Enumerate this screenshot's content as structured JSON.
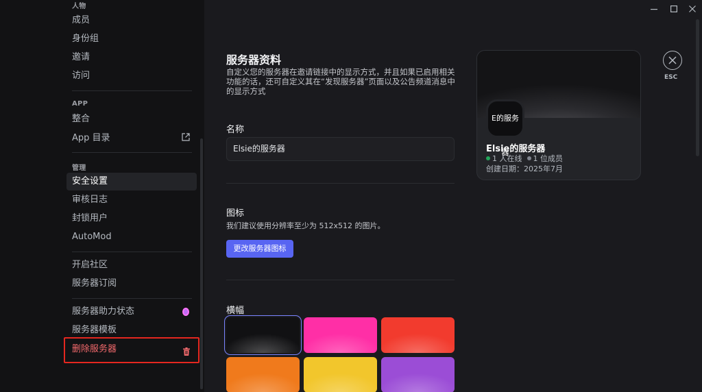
{
  "sidebar": {
    "sections": {
      "people": "人物",
      "app": "APP",
      "manage": "管理"
    },
    "items": {
      "members": "成员",
      "roles": "身份组",
      "invites": "邀请",
      "access": "访问",
      "integrations": "整合",
      "app_directory": "App 目录",
      "safety": "安全设置",
      "audit_log": "审核日志",
      "bans": "封锁用户",
      "automod": "AutoMod",
      "community": "开启社区",
      "subscriptions": "服务器订阅",
      "boost_status": "服务器助力状态",
      "template": "服务器模板",
      "delete_server": "删除服务器"
    }
  },
  "main": {
    "title": "服务器资料",
    "description": "自定义您的服务器在邀请链接中的显示方式，并且如果已启用相关功能的话，还可自定义其在“发现服务器”页面以及公告频道消息中的显示方式",
    "name_label": "名称",
    "name_value": "Elsie的服务器",
    "icon_label": "图标",
    "icon_hint": "我们建议使用分辨率至少为 512x512 的图片。",
    "change_icon_button": "更改服务器图标",
    "banner_label": "横幅"
  },
  "banners": [
    {
      "name": "black",
      "color": "#111113",
      "selected": true
    },
    {
      "name": "pink",
      "color": "#ff2fa6"
    },
    {
      "name": "red",
      "color": "#f23b2e"
    },
    {
      "name": "orange",
      "color": "#f07a1c"
    },
    {
      "name": "yellow",
      "color": "#f2c62c"
    },
    {
      "name": "purple",
      "color": "#9b4dd6"
    }
  ],
  "preview": {
    "icon_text": "E的服务器",
    "server_name": "Elsie的服务器",
    "online": "1 人在线",
    "members": "1 位成员",
    "created": "创建日期：2025年7月",
    "online_color": "#23a55a",
    "member_color": "#80848e"
  },
  "close": {
    "esc_label": "ESC"
  },
  "colors": {
    "accent": "#5865f2",
    "danger": "#f2696c",
    "highlight_box": "#e5271f"
  }
}
